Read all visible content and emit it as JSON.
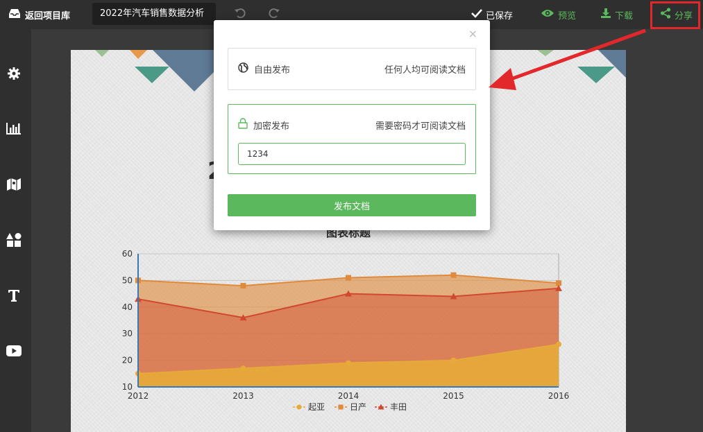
{
  "topbar": {
    "back_label": "返回项目库",
    "doc_title": "2022年汽车销售数据分析",
    "saved_label": "已保存",
    "preview_label": "预览",
    "download_label": "下载",
    "share_label": "分享"
  },
  "sidebar": {
    "icons": [
      "gear-icon",
      "bar-chart-icon",
      "map-icon",
      "shapes-icon",
      "text-icon",
      "video-icon"
    ]
  },
  "canvas": {
    "title_fragment": "2",
    "chart_title": "图表标题"
  },
  "dialog": {
    "close_label": "×",
    "free": {
      "label": "自由发布",
      "desc": "任何人均可阅读文档"
    },
    "lock": {
      "label": "加密发布",
      "desc": "需要密码才可阅读文档",
      "password": "1234"
    },
    "publish_label": "发布文档"
  },
  "colors": {
    "accent_green": "#5cb85c",
    "highlight_red": "#e3282b",
    "kia": "#e6a93a",
    "nissan": "#e08a3c",
    "toyota": "#d0492f"
  },
  "chart_data": {
    "type": "area",
    "title": "图表标题",
    "x": [
      "2012",
      "2013",
      "2014",
      "2015",
      "2016"
    ],
    "ylim": [
      10,
      60
    ],
    "yticks": [
      "10",
      "20",
      "30",
      "40",
      "50",
      "60"
    ],
    "legend_position": "bottom",
    "series": [
      {
        "name": "起亚",
        "values": [
          15,
          17,
          19,
          20,
          26
        ],
        "marker": "circle",
        "color": "#e6a93a"
      },
      {
        "name": "日产",
        "values": [
          50,
          48,
          51,
          52,
          49
        ],
        "marker": "square",
        "color": "#e08a3c"
      },
      {
        "name": "丰田",
        "values": [
          43,
          36,
          45,
          44,
          47
        ],
        "marker": "triangle",
        "color": "#d0492f"
      }
    ]
  }
}
